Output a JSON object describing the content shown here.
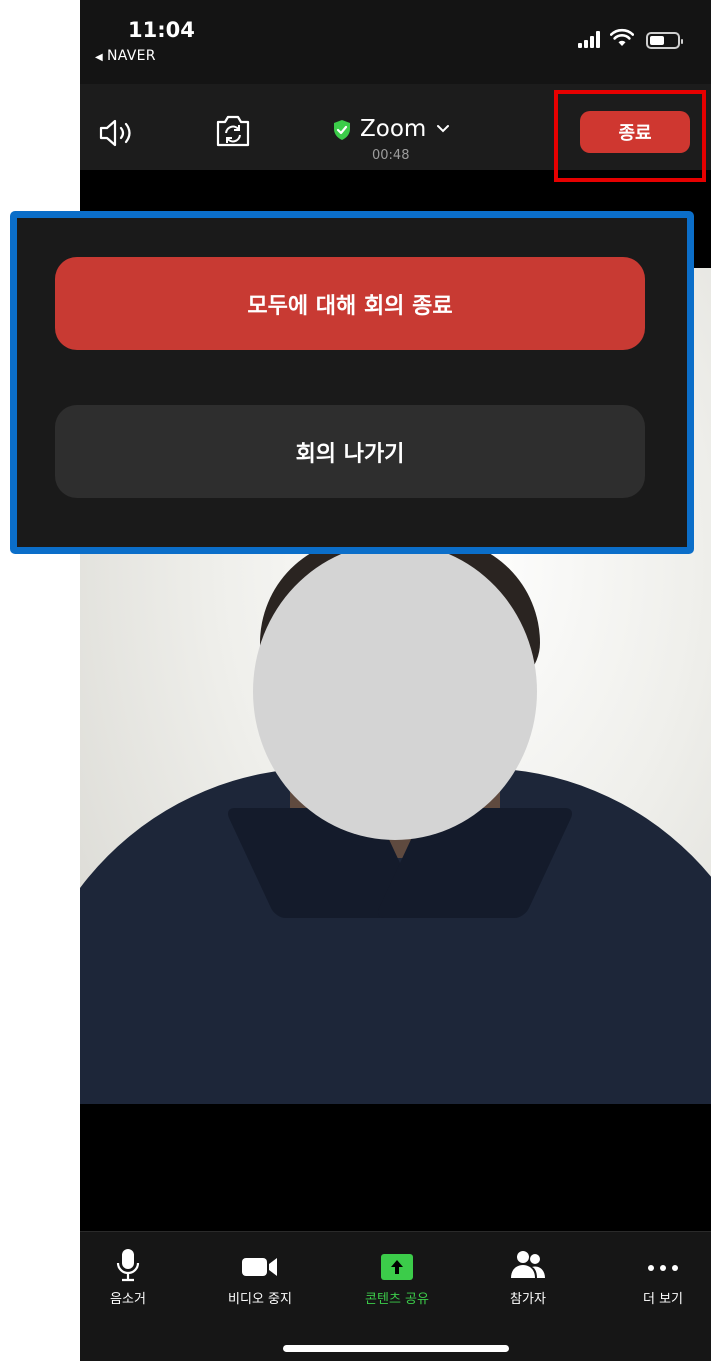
{
  "status_bar": {
    "time": "11:04",
    "back_app": "NAVER"
  },
  "top_bar": {
    "meeting_title": "Zoom",
    "elapsed_time": "00:48",
    "end_button_label": "종료"
  },
  "end_panel": {
    "end_for_all_label": "모두에 대해 회의 종료",
    "leave_meeting_label": "회의 나가기"
  },
  "toolbar": {
    "items": [
      {
        "label": "음소거",
        "icon": "microphone-icon"
      },
      {
        "label": "비디오 중지",
        "icon": "video-camera-icon"
      },
      {
        "label": "콘텐츠 공유",
        "icon": "share-screen-icon"
      },
      {
        "label": "참가자",
        "icon": "participants-icon"
      },
      {
        "label": "더 보기",
        "icon": "more-icon"
      }
    ]
  },
  "colors": {
    "end_red": "#cf3730",
    "share_green": "#3ccc4a",
    "highlight_red": "#e60000",
    "highlight_blue": "#0b6ec9"
  }
}
